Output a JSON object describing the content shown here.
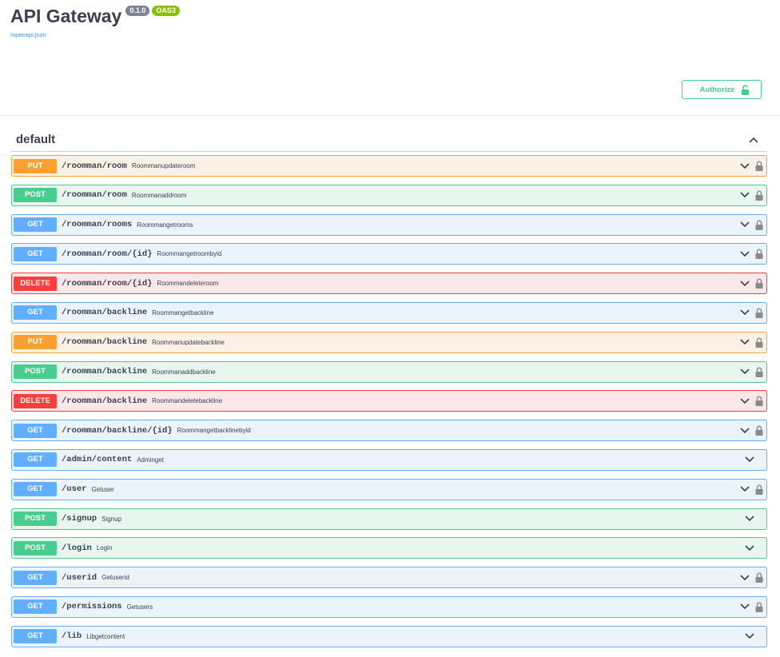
{
  "info": {
    "title": "API Gateway",
    "version": "0.1.0",
    "oas": "OAS3",
    "spec_link": "/openapi.json"
  },
  "authorize": {
    "label": "Authorize"
  },
  "section": {
    "title": "default"
  },
  "colors": {
    "get": "#61affe",
    "post": "#49cc90",
    "put": "#fca130",
    "delete": "#f93e3e",
    "accent": "#49cc90"
  },
  "operations": [
    {
      "method": "PUT",
      "path": "/roomman/room",
      "summary": "Roommanupdateroom",
      "locked": true
    },
    {
      "method": "POST",
      "path": "/roomman/room",
      "summary": "Roommanaddroom",
      "locked": true
    },
    {
      "method": "GET",
      "path": "/roomman/rooms",
      "summary": "Roommangetrooms",
      "locked": true
    },
    {
      "method": "GET",
      "path": "/roomman/room/{id}",
      "summary": "Roommangetroombyid",
      "locked": true
    },
    {
      "method": "DELETE",
      "path": "/roomman/room/{id}",
      "summary": "Roommandeleteroom",
      "locked": true
    },
    {
      "method": "GET",
      "path": "/roomman/backline",
      "summary": "Roommangetbackline",
      "locked": true
    },
    {
      "method": "PUT",
      "path": "/roomman/backline",
      "summary": "Roommanupdatebackline",
      "locked": true
    },
    {
      "method": "POST",
      "path": "/roomman/backline",
      "summary": "Roommanaddbackline",
      "locked": true
    },
    {
      "method": "DELETE",
      "path": "/roomman/backline",
      "summary": "Roommandeletebackline",
      "locked": true
    },
    {
      "method": "GET",
      "path": "/roomman/backline/{id}",
      "summary": "Roommangetbacklinebyid",
      "locked": true
    },
    {
      "method": "GET",
      "path": "/admin/content",
      "summary": "Adminget",
      "locked": false
    },
    {
      "method": "GET",
      "path": "/user",
      "summary": "Getuser",
      "locked": true
    },
    {
      "method": "POST",
      "path": "/signup",
      "summary": "Signup",
      "locked": false
    },
    {
      "method": "POST",
      "path": "/login",
      "summary": "Login",
      "locked": false
    },
    {
      "method": "GET",
      "path": "/userid",
      "summary": "Getuserid",
      "locked": true
    },
    {
      "method": "GET",
      "path": "/permissions",
      "summary": "Getusers",
      "locked": true
    },
    {
      "method": "GET",
      "path": "/lib",
      "summary": "Libgetcontent",
      "locked": false
    }
  ]
}
